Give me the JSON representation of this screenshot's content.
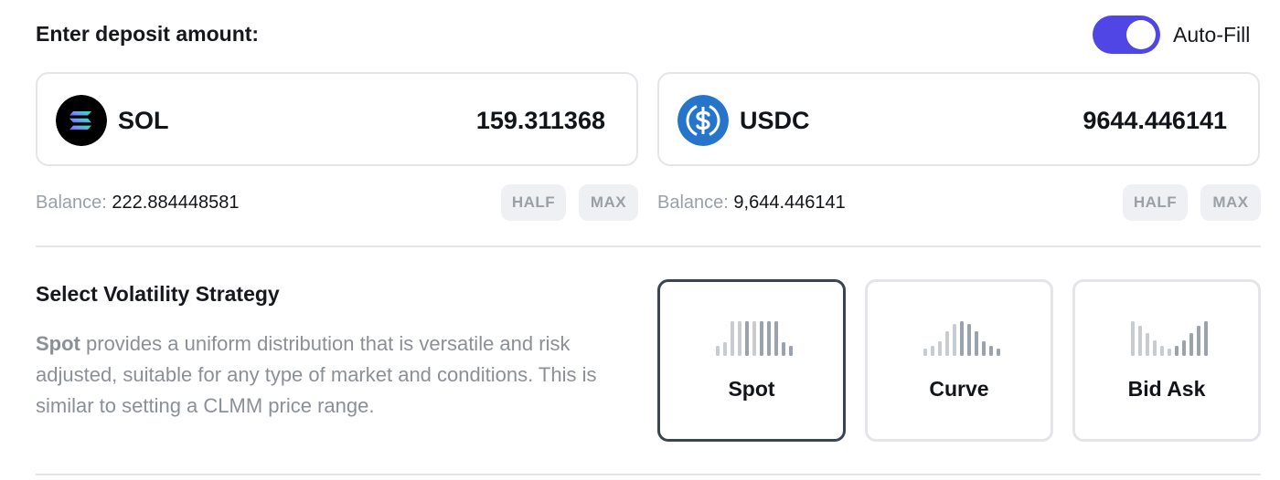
{
  "deposit": {
    "title": "Enter deposit amount:",
    "auto_fill_label": "Auto-Fill",
    "auto_fill_on": true,
    "accent_color": "#4f46e5"
  },
  "tokens": [
    {
      "symbol": "SOL",
      "amount": "159.311368",
      "balance_label": "Balance:",
      "balance_value": "222.884448581",
      "half_label": "HALF",
      "max_label": "MAX",
      "icon": "solana-icon"
    },
    {
      "symbol": "USDC",
      "amount": "9644.446141",
      "balance_label": "Balance:",
      "balance_value": "9,644.446141",
      "half_label": "HALF",
      "max_label": "MAX",
      "icon": "usdc-icon"
    }
  ],
  "volatility": {
    "title": "Select Volatility Strategy",
    "description_emphasis": "Spot",
    "description_rest": " provides a uniform distribution that is versatile and risk adjusted, suitable for any type of market and conditions. This is similar to setting a CLMM price range.",
    "strategies": [
      {
        "label": "Spot",
        "selected": true,
        "icon": "spot-distribution-icon"
      },
      {
        "label": "Curve",
        "selected": false,
        "icon": "curve-distribution-icon"
      },
      {
        "label": "Bid Ask",
        "selected": false,
        "icon": "bid-ask-distribution-icon"
      }
    ]
  }
}
